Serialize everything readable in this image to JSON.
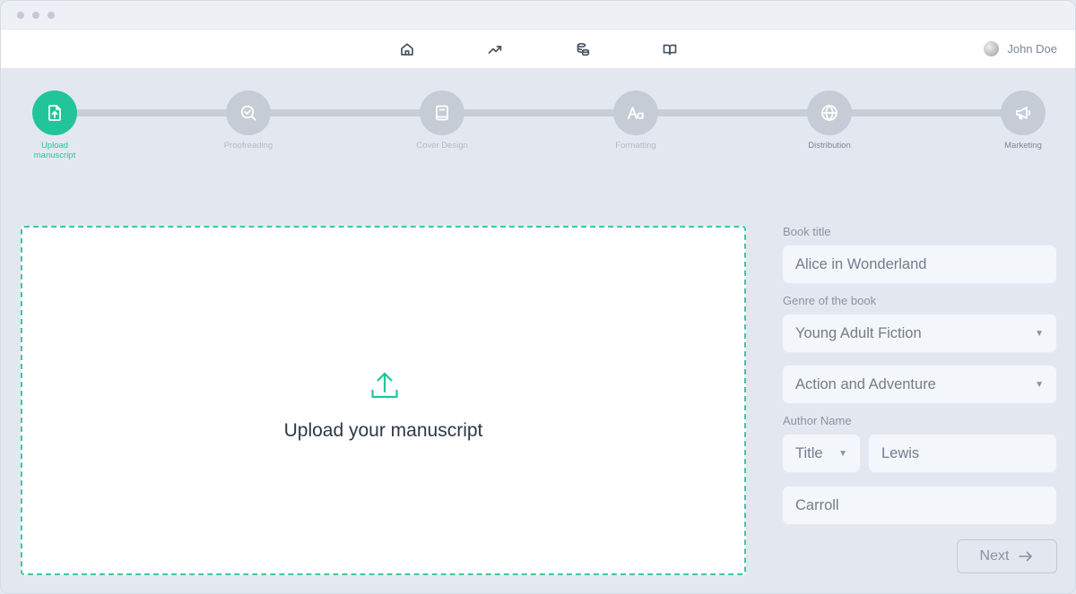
{
  "header": {
    "nav_icons": [
      "home-icon",
      "trending-up-icon",
      "database-icon",
      "book-open-icon"
    ],
    "user": {
      "name": "John Doe"
    }
  },
  "stepper": {
    "steps": [
      {
        "label": "Upload manuscript",
        "icon": "file-upload-icon",
        "state": "active"
      },
      {
        "label": "Proofreading",
        "icon": "search-check-icon",
        "state": "pending"
      },
      {
        "label": "Cover Design",
        "icon": "book-icon",
        "state": "pending"
      },
      {
        "label": "Formatting",
        "icon": "typography-icon",
        "state": "pending"
      },
      {
        "label": "Distribution",
        "icon": "globe-icon",
        "state": "done"
      },
      {
        "label": "Marketing",
        "icon": "megaphone-icon",
        "state": "done"
      }
    ],
    "colors": {
      "active": "#22c59a",
      "inactive": "#c5ccd6"
    }
  },
  "upload": {
    "text": "Upload your manuscript",
    "icon": "upload-icon"
  },
  "form": {
    "book_title_label": "Book title",
    "book_title_value": "Alice in Wonderland",
    "genre_label": "Genre of the book",
    "genre_primary": "Young Adult Fiction",
    "genre_secondary": "Action and Adventure",
    "author_label": "Author Name",
    "author_title": "Title",
    "author_first": "Lewis",
    "author_last": "Carroll",
    "next_label": "Next"
  }
}
